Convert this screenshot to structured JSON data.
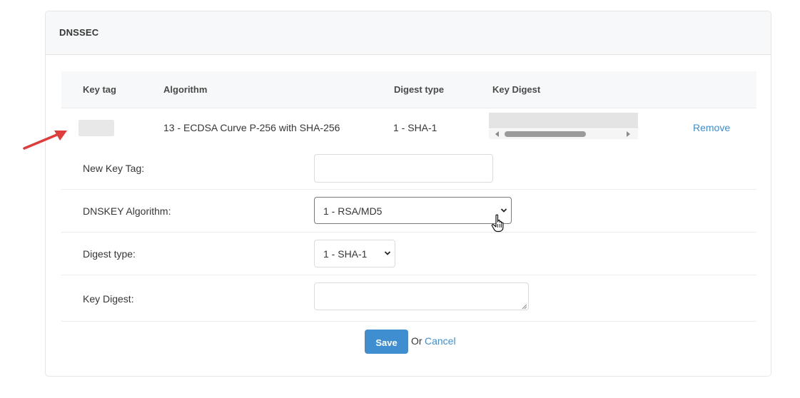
{
  "section": {
    "title": "DNSSEC"
  },
  "table": {
    "headers": {
      "key_tag": "Key tag",
      "algorithm": "Algorithm",
      "digest_type": "Digest type",
      "key_digest": "Key Digest"
    },
    "rows": [
      {
        "key_tag": "",
        "algorithm": "13 - ECDSA Curve P-256 with SHA-256",
        "digest_type": "1 - SHA-1",
        "key_digest": "",
        "remove_label": "Remove"
      }
    ]
  },
  "form": {
    "new_key_tag": {
      "label": "New Key Tag:",
      "value": "",
      "placeholder": ""
    },
    "dnskey_algorithm": {
      "label": "DNSKEY Algorithm:",
      "selected": "1 - RSA/MD5"
    },
    "digest_type": {
      "label": "Digest type:",
      "selected": "1 - SHA-1"
    },
    "key_digest": {
      "label": "Key Digest:",
      "value": ""
    },
    "save_label": "Save",
    "or_text": "Or",
    "cancel_label": "Cancel"
  },
  "colors": {
    "accent": "#3e8ed0",
    "header_bg": "#f7f8f9",
    "annotation_arrow": "#e03c3c",
    "redaction": "#e4e4e4"
  },
  "icons": {
    "select_chevron": "chevron-down-icon",
    "annotation": "red-arrow-icon",
    "cursor": "hand-pointer-icon"
  }
}
